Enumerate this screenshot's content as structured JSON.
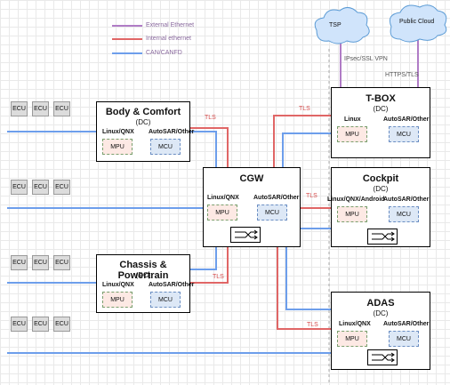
{
  "legend": {
    "external": "External Ethernet",
    "internal": "Internal ethernet",
    "can": "CAN/CANFD",
    "colors": {
      "external": "#b07cc6",
      "internal": "#e06666",
      "can": "#6d9eeb"
    }
  },
  "clouds": {
    "tsp": "TSP",
    "public": "Public Cloud"
  },
  "links": {
    "vpn": "IPsec/SSL VPN",
    "https": "HTTPS/TLS",
    "tls": "TLS"
  },
  "ecu_label": "ECU",
  "boxes": {
    "body": {
      "title": "Body & Comfort",
      "sub": "(DC)",
      "os_left": "Linux/QNX",
      "os_right": "AutoSAR/Other",
      "mpu": "MPU",
      "mcu": "MCU"
    },
    "chassis": {
      "title": "Chassis & Powertrain",
      "sub": "(DC)",
      "os_left": "Linux/QNX",
      "os_right": "AutoSAR/Other",
      "mpu": "MPU",
      "mcu": "MCU"
    },
    "cgw": {
      "title": "CGW",
      "os_left": "Linux/QNX",
      "os_right": "AutoSAR/Other",
      "mpu": "MPU",
      "mcu": "MCU"
    },
    "tbox": {
      "title": "T-BOX",
      "sub": "(DC)",
      "os_left": "Linux",
      "os_right": "AutoSAR/Other",
      "mpu": "MPU",
      "mcu": "MCU"
    },
    "cockpit": {
      "title": "Cockpit",
      "sub": "(DC)",
      "os_left": "Linux/QNX/Android",
      "os_right": "AutoSAR/Other",
      "mpu": "MPU",
      "mcu": "MCU"
    },
    "adas": {
      "title": "ADAS",
      "sub": "(DC)",
      "os_left": "Linux/QNX",
      "os_right": "AutoSAR/Other",
      "mpu": "MPU",
      "mcu": "MCU"
    }
  }
}
